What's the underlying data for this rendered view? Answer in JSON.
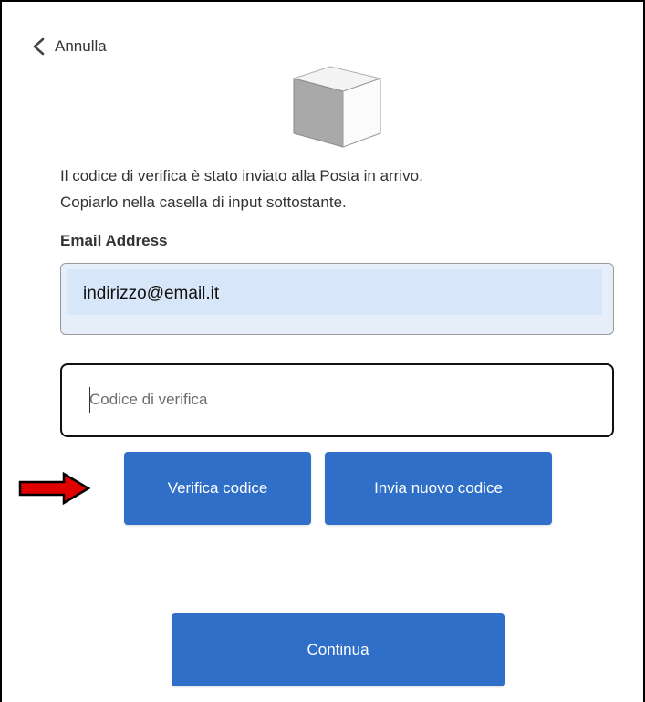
{
  "nav": {
    "back_label": "Annulla",
    "back_icon": "chevron-left-icon"
  },
  "logo": {
    "icon": "cube-icon"
  },
  "intro": {
    "line1": "Il codice di verifica è stato inviato alla Posta in arrivo.",
    "line2": "Copiarlo nella casella di input sottostante."
  },
  "email": {
    "label": "Email Address",
    "value": "indirizzo@email.it"
  },
  "code": {
    "placeholder": "Codice di verifica",
    "value": ""
  },
  "buttons": {
    "verify_label": "Verifica codice",
    "resend_label": "Invia nuovo codice",
    "continue_label": "Continua"
  },
  "annotation": {
    "icon": "red-arrow-icon"
  },
  "colors": {
    "button_blue": "#2f6fc8",
    "email_field_bg": "#e6eef9",
    "arrow_red": "#e00000"
  }
}
